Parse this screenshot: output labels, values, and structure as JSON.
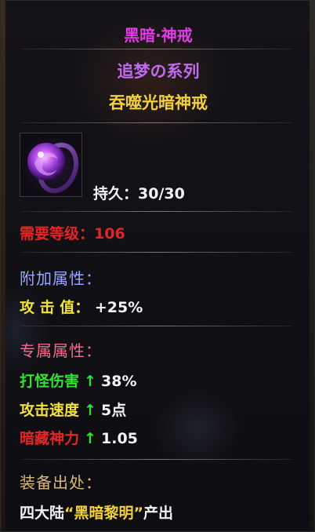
{
  "title": "黑暗·神戒",
  "series": "追梦の系列",
  "subtitle": "吞噬光暗神戒",
  "item_icon": "purple-ring",
  "durability": {
    "label": "持久：",
    "value": "30/30"
  },
  "requirement": {
    "label": "需要等级：",
    "value": "106"
  },
  "bonus": {
    "header": "附加属性：",
    "stats": [
      {
        "label": "攻 击 值：",
        "value": "+25%"
      }
    ]
  },
  "exclusive": {
    "header": "专属属性：",
    "stats": [
      {
        "label": "打怪伤害",
        "value": "38%",
        "color": "#33e033"
      },
      {
        "label": "攻击速度",
        "value": "5点",
        "color": "#f3e23a"
      },
      {
        "label": "暗藏神力",
        "value": "1.05",
        "color": "#e42525"
      }
    ],
    "arrow": "↑"
  },
  "source": {
    "header": "装备出处：",
    "prefix": "四大陆",
    "highlight": "“黑暗黎明”",
    "suffix": "产出"
  },
  "colors": {
    "title": "#e03ce6",
    "series": "#c06af0",
    "subtitle": "#f2d13a",
    "section_header_bonus": "#9aa6ff",
    "section_header_exclusive": "#f06b8e",
    "section_header_source": "#d8b878",
    "highlight": "#f2d13a"
  }
}
